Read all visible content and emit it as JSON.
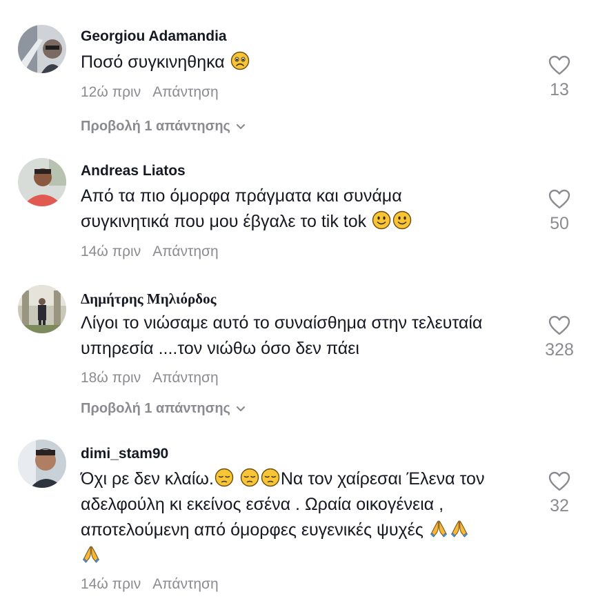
{
  "comments": [
    {
      "username": "Georgiou Adamandia",
      "text": "Ποσό συγκινηθηκα",
      "time": "12ώ πριν",
      "reply_label": "Απάντηση",
      "likes": "13",
      "view_replies": "Προβολή 1 απάντησης",
      "emojis": [
        "sad-face"
      ]
    },
    {
      "username": "Andreas Liatos",
      "text_line1": "Από τα πιο όμορφα πράγματα και συνάμα",
      "text_line2": "συγκινητικά που μου έβγαλε το tik tok",
      "time": "14ώ πριν",
      "reply_label": "Απάντηση",
      "likes": "50",
      "emojis": [
        "slight-smile",
        "slight-smile"
      ]
    },
    {
      "username": "Δημήτρης Μηλιόρδος",
      "text_line1": "Λίγοι το νιώσαμε αυτό το συναίσθημα στην τελευταία",
      "text_line2": "υπηρεσία ....τον νιώθω όσο δεν πάει",
      "time": "18ώ πριν",
      "reply_label": "Απάντηση",
      "likes": "328",
      "view_replies": "Προβολή 1 απάντησης"
    },
    {
      "username": "dimi_stam90",
      "text_part1": "Όχι ρε δεν κλαίω.",
      "text_part2": "Να τον χαίρεσαι Έλενα τον",
      "text_line2": "αδελφούλη κι εκείνος εσένα . Ωραία οικογένεια ,",
      "text_line3": "αποτελούμενη από όμορφες ευγενικές ψυχές",
      "time": "14ώ πριν",
      "reply_label": "Απάντηση",
      "likes": "32",
      "emojis": [
        "pensive",
        "pensive",
        "pensive",
        "folded-hands",
        "folded-hands",
        "folded-hands"
      ]
    }
  ]
}
